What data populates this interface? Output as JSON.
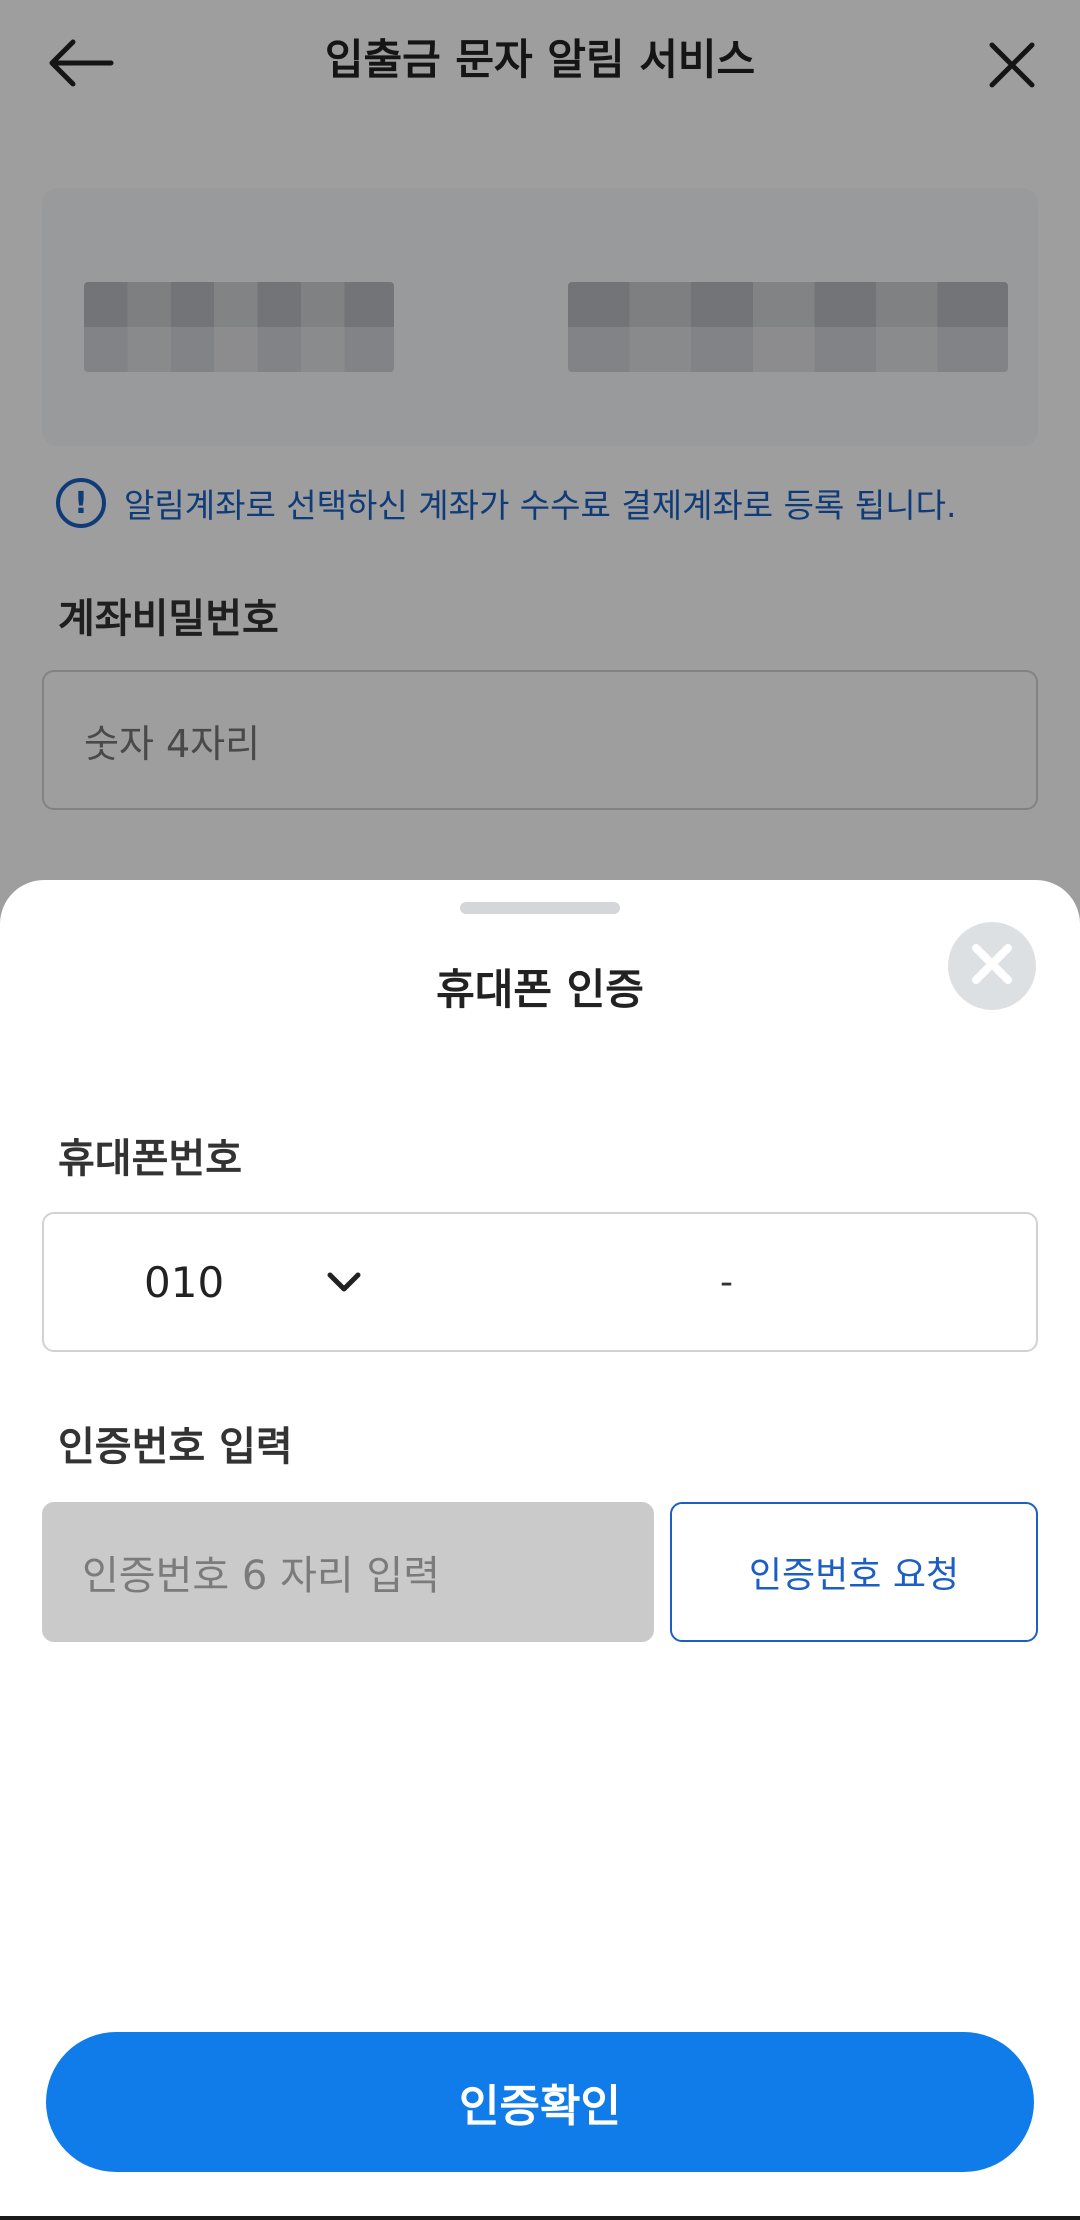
{
  "appbar": {
    "title": "입출금 문자 알림 서비스",
    "back_icon": "arrow-left-icon",
    "close_icon": "close-icon"
  },
  "account_card": {
    "masked": true
  },
  "notice": {
    "icon": "exclamation-circle-icon",
    "text": "알림계좌로 선택하신 계좌가 수수료 결제계좌로 등록 됩니다."
  },
  "password": {
    "label": "계좌비밀번호",
    "placeholder": "숫자 4자리"
  },
  "sheet": {
    "title": "휴대폰 인증",
    "close_icon": "close-circle-icon",
    "phone": {
      "label": "휴대폰번호",
      "prefix": "010",
      "separator": "-",
      "chevron_icon": "chevron-down-icon"
    },
    "code": {
      "label": "인증번호 입력",
      "placeholder": "인증번호 6 자리 입력",
      "request_label": "인증번호 요청"
    },
    "confirm_label": "인증확인"
  },
  "colors": {
    "accent": "#0f7ce9",
    "link_blue": "#1b5fc4",
    "dim_overlay": "rgba(0,0,0,0.38)"
  }
}
